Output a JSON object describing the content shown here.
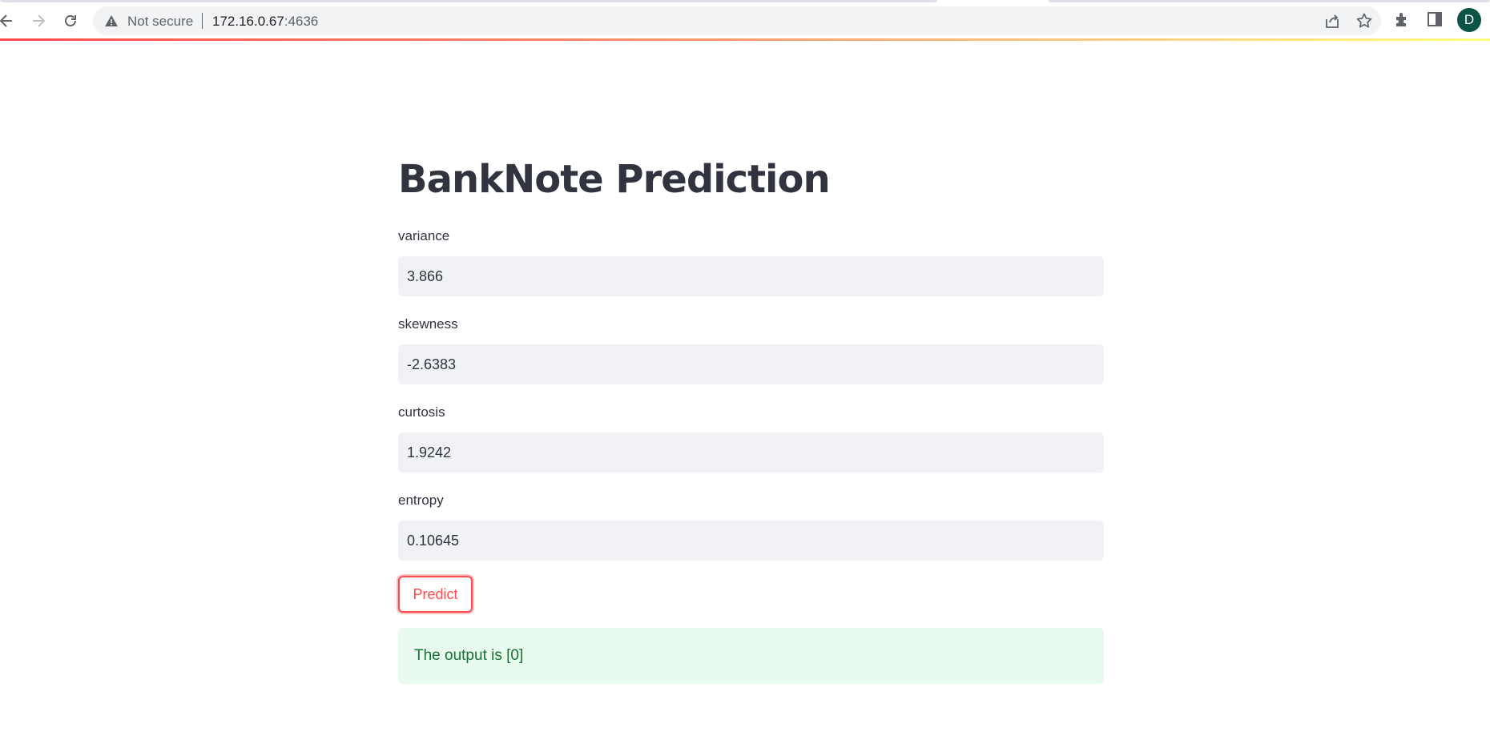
{
  "browser": {
    "security_label": "Not secure",
    "url_host": "172.16.0.67",
    "url_port": ":4636",
    "profile_initial": "D"
  },
  "app": {
    "title": "BankNote Prediction",
    "fields": [
      {
        "label": "variance",
        "value": "3.866"
      },
      {
        "label": "skewness",
        "value": "-2.6383"
      },
      {
        "label": "curtosis",
        "value": "1.9242"
      },
      {
        "label": "entropy",
        "value": "0.10645"
      }
    ],
    "predict_label": "Predict",
    "output_text": "The output is [0]"
  },
  "colors": {
    "accent": "#ff4b4b",
    "success_bg": "#e8f9ee",
    "success_text": "#177233",
    "input_bg": "#f0f2f6",
    "text": "#31333f",
    "avatar_bg": "#0b5345"
  }
}
